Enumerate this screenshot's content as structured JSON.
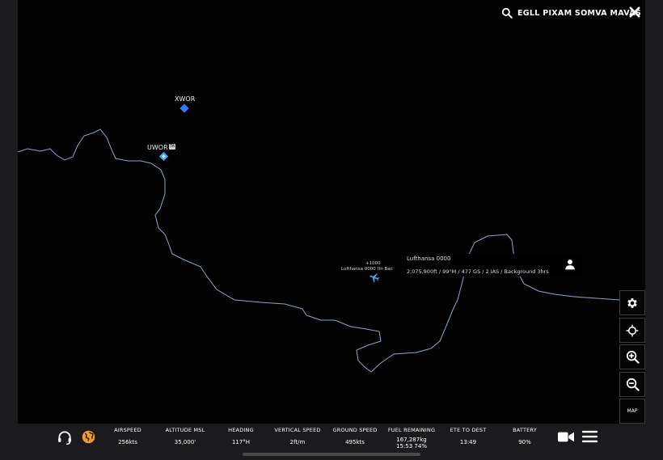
{
  "header": {
    "route": "EGLL PIXAM SOMVA MAVAS",
    "search_icon": "search-icon",
    "close_icon": "close-icon"
  },
  "map": {
    "waypoints": [
      {
        "id": "XWOR",
        "label": "XWOR",
        "color": "#2f7df6"
      },
      {
        "id": "UWOR",
        "label": "UWOR",
        "badge": "TA",
        "color": "#4aa3f0"
      }
    ],
    "coastline_color": "#8fa6c8",
    "aircraft_label": {
      "top": "+1000",
      "bottom": "Lufthansa 0000 (In Bac"
    },
    "callout": {
      "name": "Lufthansa 0000",
      "info": "2,075,900ft / 99°M / 477 GS / 2 IAS / Background 3hrs",
      "person_icon": "person-icon"
    }
  },
  "controls": [
    {
      "id": "settings",
      "icon": "gear-icon"
    },
    {
      "id": "center",
      "icon": "crosshair-icon"
    },
    {
      "id": "zoom-in",
      "icon": "zoom-in-icon"
    },
    {
      "id": "zoom-out",
      "icon": "zoom-out-icon"
    },
    {
      "id": "map",
      "label": "MAP"
    }
  ],
  "bottom_bar": {
    "stats": [
      {
        "label": "AIRSPEED",
        "value": "256kts"
      },
      {
        "label": "ALTITUDE MSL",
        "value": "35,000'"
      },
      {
        "label": "HEADING",
        "value": "117°H"
      },
      {
        "label": "VERTICAL SPEED",
        "value": "2ft/m"
      },
      {
        "label": "GROUND SPEED",
        "value": "495kts"
      },
      {
        "label": "FUEL REMAINING",
        "value": "167,287kg",
        "value2": "15:53 74%"
      },
      {
        "label": "ETE TO DEST",
        "value": "13:49"
      },
      {
        "label": "BATTERY",
        "value": "90%"
      }
    ],
    "accent_color": "#f29a2e"
  }
}
